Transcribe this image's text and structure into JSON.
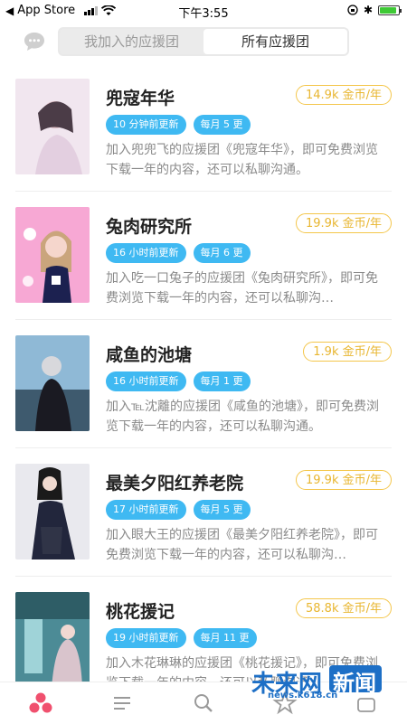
{
  "status_bar": {
    "carrier": "App Store",
    "time": "下午3:55"
  },
  "header": {
    "tabs": [
      {
        "label": "我加入的应援团",
        "active": false
      },
      {
        "label": "所有应援团",
        "active": true
      }
    ]
  },
  "groups": [
    {
      "title": "兜寇年华",
      "price": "14.9k 金币/年",
      "tags": [
        "10 分钟前更新",
        "每月 5 更"
      ],
      "description": "加入兜兜飞的应援团《兜寇年华》，即可免费浏览下载一年的内容，还可以私聊沟通。"
    },
    {
      "title": "兔肉研究所",
      "price": "19.9k 金币/年",
      "tags": [
        "16 小时前更新",
        "每月 6 更"
      ],
      "description": "加入吃一口兔子的应援团《兔肉研究所》，即可免费浏览下载一年的内容，还可以私聊沟…"
    },
    {
      "title": "咸鱼的池塘",
      "price": "1.9k 金币/年",
      "tags": [
        "16 小时前更新",
        "每月 1 更"
      ],
      "description": "加入℡沈離的应援团《咸鱼的池塘》，即可免费浏览下载一年的内容，还可以私聊沟通。"
    },
    {
      "title": "最美夕阳红养老院",
      "price": "19.9k 金币/年",
      "tags": [
        "17 小时前更新",
        "每月 5 更"
      ],
      "description": "加入眼大王的应援团《最美夕阳红养老院》，即可免费浏览下载一年的内容，还可以私聊沟…"
    },
    {
      "title": "桃花援记",
      "price": "58.8k 金币/年",
      "tags": [
        "19 小时前更新",
        "每月 11 更"
      ],
      "description": "加入木花琳琳的应援团《桃花援记》，即可免费浏览下载一年的内容，还可以私聊沟通。"
    }
  ],
  "tabbar": {
    "icons": [
      "groups-icon",
      "list-icon",
      "search-icon",
      "star-icon",
      "profile-icon"
    ]
  },
  "watermark": {
    "brand": "未来网",
    "brand2": "新闻",
    "url": "news.k618.cn"
  },
  "colors": {
    "accent_blue": "#3fb9f2",
    "price_gold": "#e8b630",
    "tab_active_pink": "#f0506e"
  }
}
